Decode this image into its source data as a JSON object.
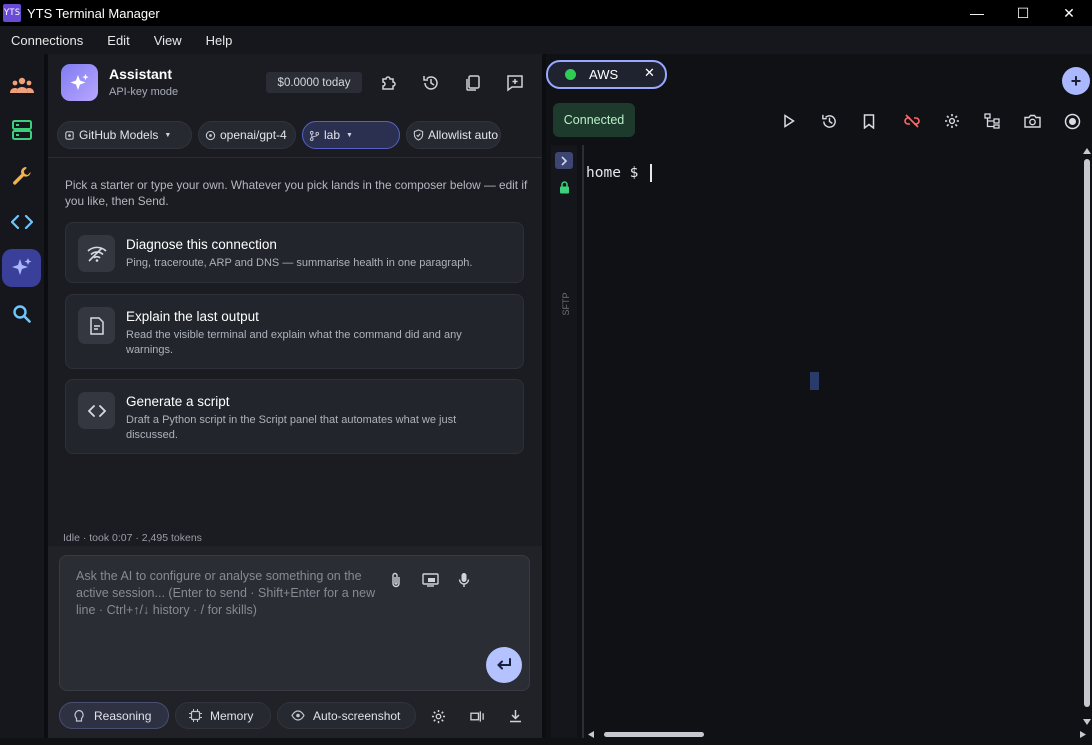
{
  "window": {
    "title": "YTS Terminal Manager",
    "logo_text": "YTS",
    "controls": {
      "minimize": "—",
      "maximize": "☐",
      "close": "✕"
    }
  },
  "menu": [
    "Connections",
    "Edit",
    "View",
    "Help"
  ],
  "rail": [
    "team-icon",
    "servers-icon",
    "wrench-icon",
    "code-icon",
    "sparkles-icon",
    "search-icon"
  ],
  "assistant": {
    "title": "Assistant",
    "subtitle": "API-key mode",
    "cost": "$0.0000 today",
    "pills": {
      "provider": "GitHub Models",
      "model": "openai/gpt-4",
      "profile": "lab",
      "policy": "Allowlist auto"
    },
    "intro": "Pick a starter or type your own. Whatever you pick lands in the composer below — edit if you like, then Send.",
    "cards": [
      {
        "title": "Diagnose this connection",
        "desc": "Ping, traceroute, ARP and DNS — summarise health in one paragraph."
      },
      {
        "title": "Explain the last output",
        "desc": "Read the visible terminal and explain what the command did and any warnings."
      },
      {
        "title": "Generate a script",
        "desc": "Draft a Python script in the Script panel that automates what we just discussed."
      }
    ],
    "status": "Idle · took 0:07 · 2,495 tokens",
    "composer_placeholder": "Ask the AI to configure or analyse something on the active session... (Enter to send · Shift+Enter for a new line · Ctrl+↑/↓ history · / for skills)",
    "toggles": {
      "reasoning": "Reasoning",
      "memory": "Memory",
      "autoshot": "Auto-screenshot"
    }
  },
  "session": {
    "tab_label": "AWS",
    "tab_close": "✕",
    "add": "+",
    "status": "Connected",
    "status_color": "#2ecc55",
    "side_label": "SFTP",
    "prompt": "home $"
  }
}
